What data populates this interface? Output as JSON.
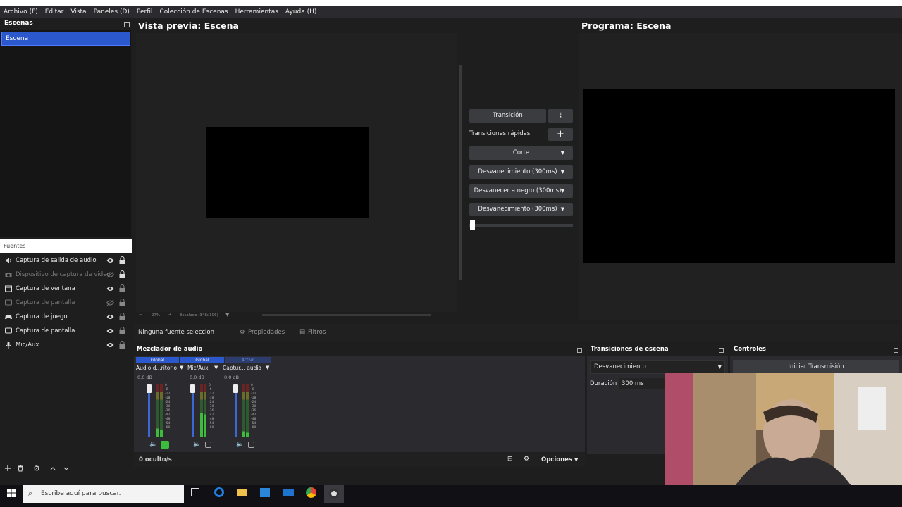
{
  "menu": [
    "Archivo (F)",
    "Editar",
    "Vista",
    "Paneles (D)",
    "Perfil",
    "Colección de Escenas",
    "Herramientas",
    "Ayuda (H)"
  ],
  "scenes": {
    "header": "Escenas",
    "items": [
      "Escena"
    ]
  },
  "sources": {
    "header": "Fuentes",
    "items": [
      {
        "label": "Captura de salida de audio",
        "icon": "speaker-icon",
        "visible": true
      },
      {
        "label": "Dispositivo de captura de video",
        "icon": "camera-icon",
        "visible": false
      },
      {
        "label": "Captura de ventana",
        "icon": "window-icon",
        "visible": true
      },
      {
        "label": "Captura de pantalla",
        "icon": "monitor-icon",
        "visible": false
      },
      {
        "label": "Captura de juego",
        "icon": "gamepad-icon",
        "visible": true
      },
      {
        "label": "Captura de pantalla",
        "icon": "monitor-icon",
        "visible": true
      },
      {
        "label": "Mic/Aux",
        "icon": "microphone-icon",
        "visible": true
      }
    ]
  },
  "preview": {
    "title": "Vista previa: Escena",
    "zoom": "27%",
    "scale": "Escalado (348x196)"
  },
  "program": {
    "title": "Programa: Escena"
  },
  "transitions": {
    "transition_button": "Transición",
    "quick_label": "Transiciones rápidas",
    "quick_items": [
      "Corte",
      "Desvanecimiento (300ms)",
      "Desvanecer a negro (300ms)",
      "Desvanecimiento (300ms)"
    ]
  },
  "context_bar": {
    "no_source": "Ninguna fuente seleccionada",
    "properties": "Propiedades",
    "filters": "Filtros"
  },
  "mixer": {
    "title": "Mezclador de audio",
    "channels": [
      {
        "tag": "Global",
        "name": "Audio d...ritorio",
        "db": "0.0 dB",
        "level": 0.15,
        "monitor_active": true
      },
      {
        "tag": "Global",
        "name": "Mic/Aux",
        "db": "0.0 dB",
        "level": 0.45,
        "monitor_active": false
      },
      {
        "tag": "Activo",
        "name": "Captur... audio",
        "db": "0.0 dB",
        "level": 0.1,
        "monitor_active": false
      }
    ],
    "scale": [
      "0",
      "-6",
      "-12",
      "-18",
      "-24",
      "-30",
      "-36",
      "-42",
      "-48",
      "-54",
      "-60"
    ],
    "hidden": "0 oculto/s",
    "options": "Opciones"
  },
  "scene_transitions": {
    "title": "Transiciones de escena",
    "selected": "Desvanecimiento",
    "duration_label": "Duración",
    "duration_value": "300 ms"
  },
  "controls": {
    "title": "Controles",
    "start_stream": "Iniciar Transmisión"
  },
  "taskbar": {
    "search_placeholder": "Escribe aquí para buscar."
  },
  "colors": {
    "accent": "#2c58ce",
    "fader": "#3c68d6",
    "meter_green": "#3dbb3d"
  }
}
